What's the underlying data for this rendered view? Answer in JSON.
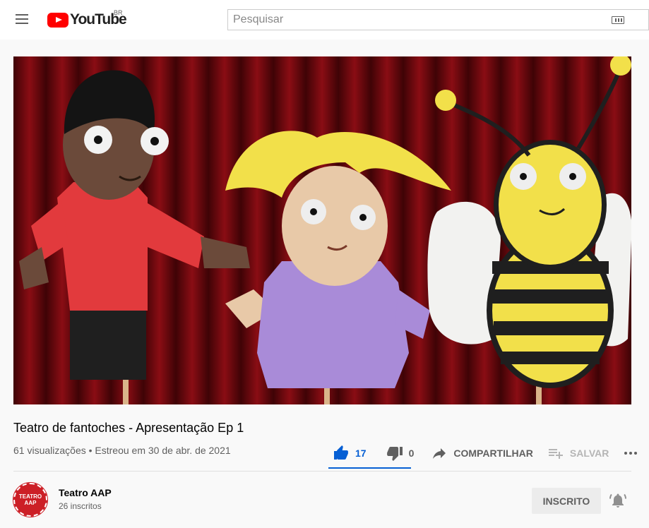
{
  "header": {
    "logo_text": "YouTube",
    "country_code": "BR",
    "search_placeholder": "Pesquisar"
  },
  "video": {
    "title": "Teatro de fantoches - Apresentação Ep 1",
    "views": "61 visualizações",
    "separator": "•",
    "premiere_date": "Estreou em 30 de abr. de 2021"
  },
  "actions": {
    "like_count": "17",
    "dislike_count": "0",
    "share_label": "COMPARTILHAR",
    "save_label": "SALVAR"
  },
  "channel": {
    "name": "Teatro AAP",
    "subscribers": "26 inscritos",
    "avatar_line1": "TEATRO",
    "avatar_line2": "AAP",
    "subscribe_label": "INSCRITO"
  },
  "colors": {
    "accent": "#065fd4",
    "brand": "#ff0000",
    "avatar": "#cc1f26"
  }
}
